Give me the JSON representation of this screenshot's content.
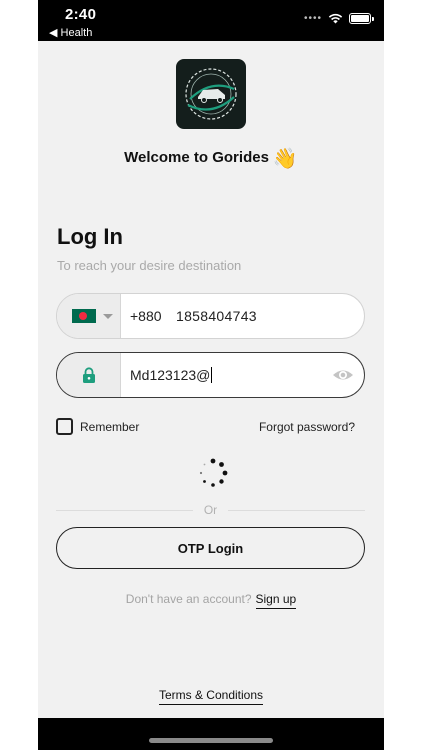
{
  "status_bar": {
    "time": "2:40",
    "back_label": "◀ Health"
  },
  "app": {
    "welcome": "Welcome to Gorides",
    "wave_emoji": "👋"
  },
  "login": {
    "title": "Log In",
    "subtitle": "To reach your desire destination",
    "phone": {
      "country_code": "+880",
      "number": "1858404743",
      "flag": "bangladesh-flag"
    },
    "password": {
      "value": "Md123123@"
    },
    "remember_label": "Remember",
    "forgot_label": "Forgot password?",
    "divider_label": "Or",
    "otp_button": "OTP Login",
    "no_account": "Don't have an account?",
    "signup_link": "Sign up",
    "terms_link": "Terms & Conditions"
  },
  "colors": {
    "accent": "#1e9e7e",
    "background": "#f1f1f1",
    "logo_bg": "#141e1c"
  }
}
